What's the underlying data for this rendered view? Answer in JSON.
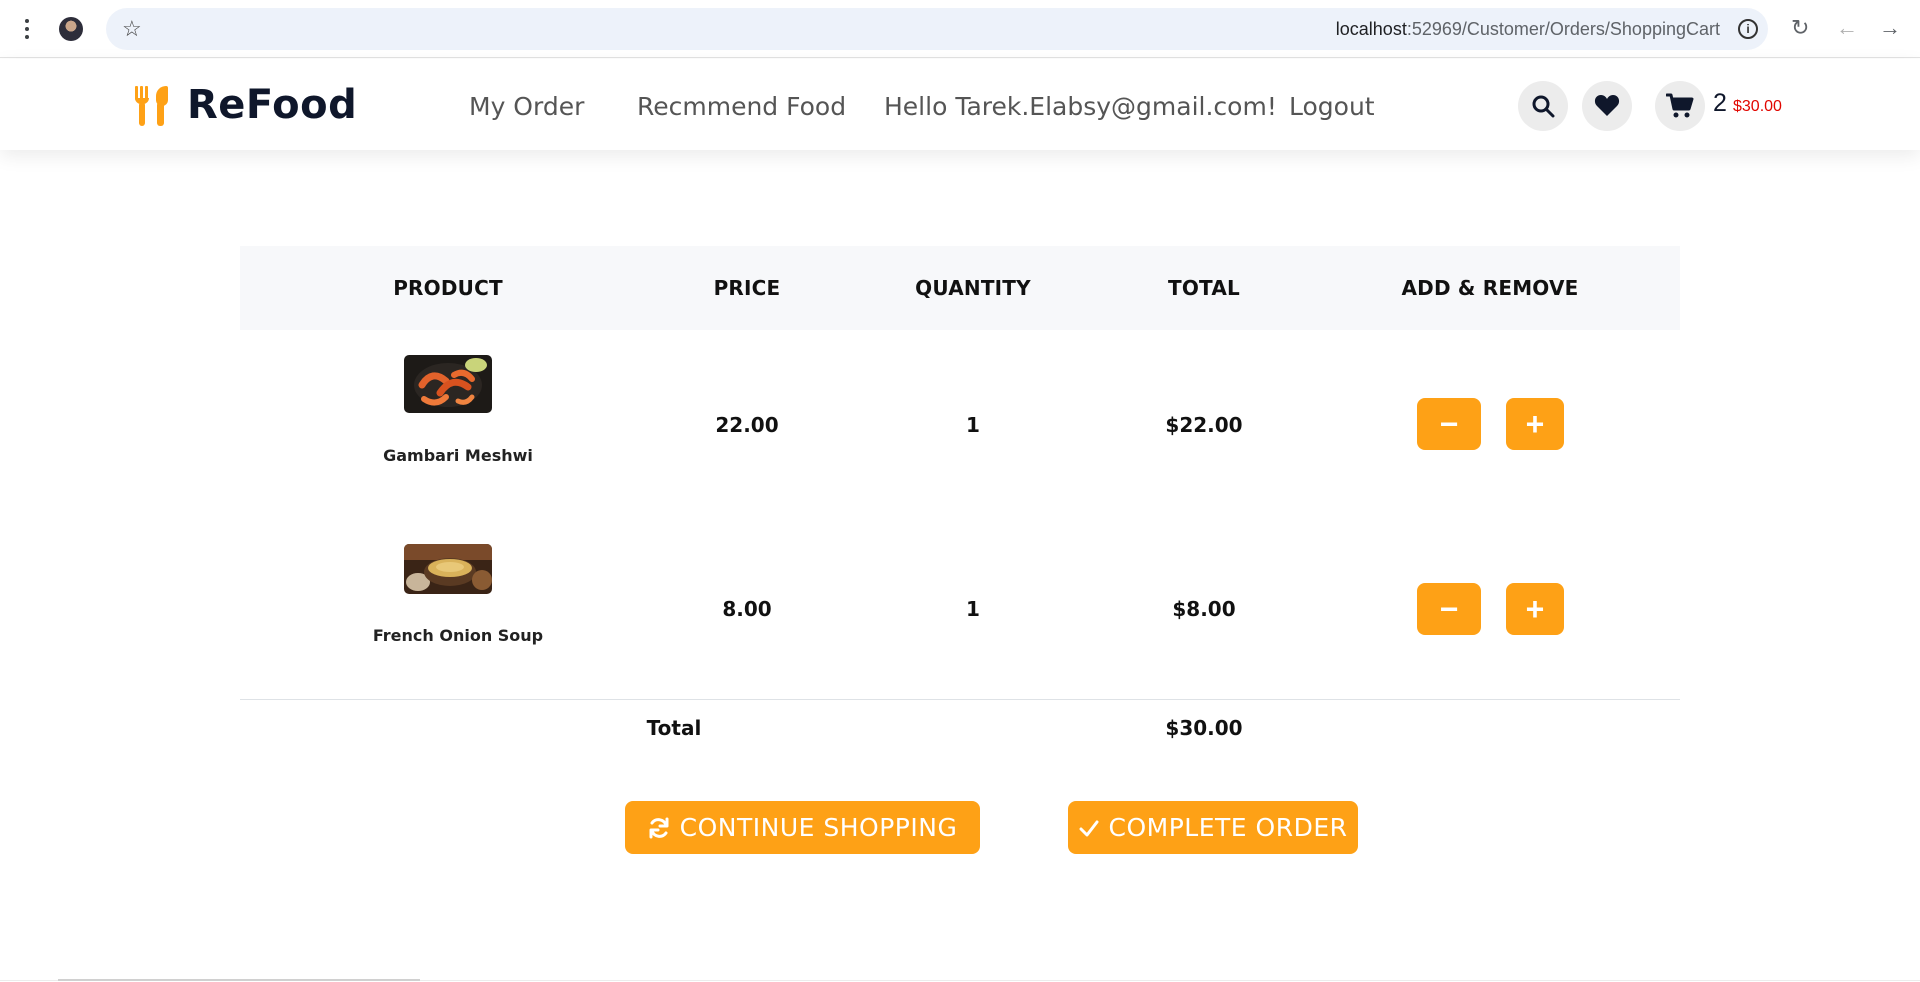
{
  "browser": {
    "url_host": "localhost",
    "url_path": ":52969/Customer/Orders/ShoppingCart"
  },
  "header": {
    "logo_text": "ReFood",
    "nav": [
      {
        "label": "My Order"
      },
      {
        "label": "Recmmend Food"
      },
      {
        "label": "Hello Tarek.Elabsy@gmail.com!"
      },
      {
        "label": "Logout"
      }
    ],
    "cart_count": "2",
    "cart_total": "$30.00"
  },
  "table": {
    "headers": [
      "PRODUCT",
      "PRICE",
      "QUANTITY",
      "TOTAL",
      "ADD & REMOVE"
    ],
    "rows": [
      {
        "name": "Gambari Meshwi",
        "price": "22.00",
        "quantity": "1",
        "total": "$22.00",
        "minus": "−",
        "plus": "+"
      },
      {
        "name": "French Onion Soup",
        "price": "8.00",
        "quantity": "1",
        "total": "$8.00",
        "minus": "−",
        "plus": "+"
      }
    ],
    "total_label": "Total",
    "grand_total": "$30.00"
  },
  "actions": {
    "continue_label": "CONTINUE SHOPPING",
    "complete_label": "COMPLETE ORDER"
  },
  "colors": {
    "accent": "#fea116",
    "brand_dark": "#0f172b",
    "cart_total_red": "#e10600"
  }
}
